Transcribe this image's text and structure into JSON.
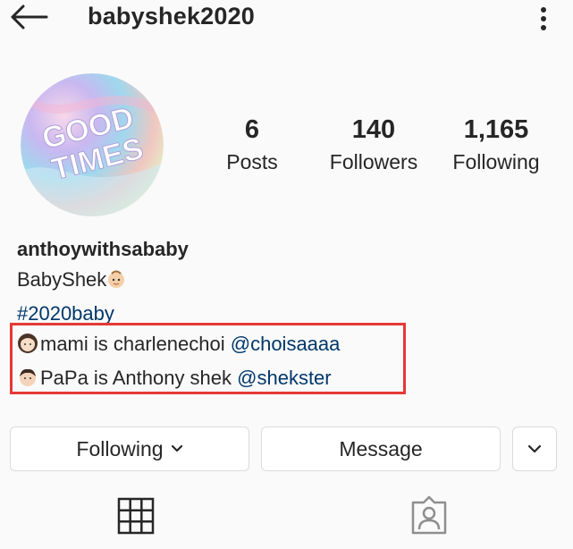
{
  "header": {
    "username": "babyshek2020",
    "back_icon": "arrow-left-icon",
    "more_icon": "more-vertical-icon"
  },
  "profile": {
    "avatar_text": "GOOD TIMES",
    "stats": {
      "posts": {
        "value": "6",
        "label": "Posts"
      },
      "followers": {
        "value": "140",
        "label": "Followers"
      },
      "following": {
        "value": "1,165",
        "label": "Following"
      }
    }
  },
  "bio": {
    "name": "anthoywithsababy",
    "line1": "BabyShek",
    "hashtag": "#2020baby",
    "line3_text": "mami is charlenechoi ",
    "line3_mention": "@choisaaaa",
    "line4_text": "PaPa is Anthony shek ",
    "line4_mention": "@shekster"
  },
  "actions": {
    "following_label": "Following",
    "message_label": "Message"
  },
  "tabs": {
    "grid_icon": "grid-icon",
    "tagged_icon": "tagged-person-icon"
  },
  "colors": {
    "highlight": "#e53935",
    "mention": "#00376b",
    "text": "#262626"
  }
}
